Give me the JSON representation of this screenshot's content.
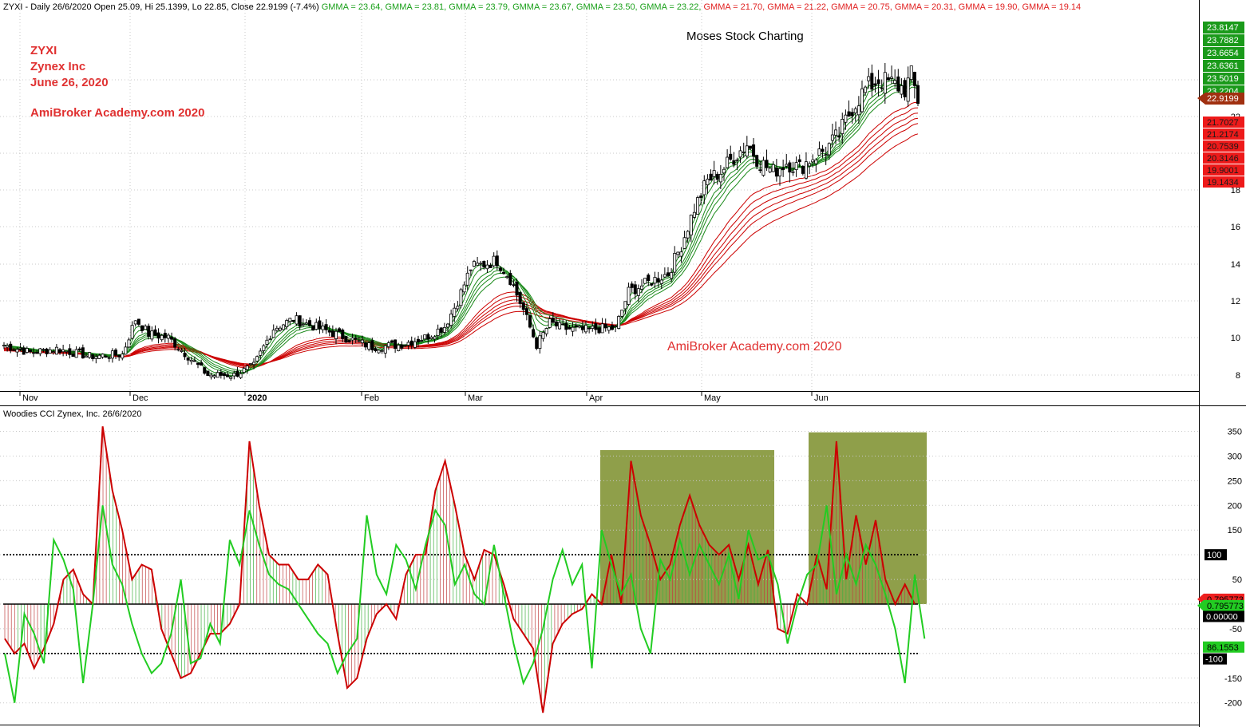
{
  "header": {
    "symbol": "ZYXI",
    "info": " - Daily 26/6/2020 Open 25.09, Hi 25.1399, Lo 22.85, Close 22.9199 (-7.4%)",
    "gmma": [
      {
        "text": "GMMA = 23.64,",
        "color": "#1aa01a"
      },
      {
        "text": "GMMA = 23.81,",
        "color": "#1aa01a"
      },
      {
        "text": "GMMA = 23.79,",
        "color": "#1aa01a"
      },
      {
        "text": "GMMA = 23.67,",
        "color": "#1aa01a"
      },
      {
        "text": "GMMA = 23.50,",
        "color": "#1aa01a"
      },
      {
        "text": "GMMA = 23.22,",
        "color": "#1aa01a"
      },
      {
        "text": "GMMA = 21.70,",
        "color": "#e02020"
      },
      {
        "text": "GMMA = 21.22,",
        "color": "#e02020"
      },
      {
        "text": "GMMA = 20.75,",
        "color": "#e02020"
      },
      {
        "text": "GMMA = 20.31,",
        "color": "#e02020"
      },
      {
        "text": "GMMA = 19.90,",
        "color": "#e02020"
      },
      {
        "text": "GMMA = 19.14",
        "color": "#e02020"
      }
    ]
  },
  "annotations": {
    "ticker": "ZYXI",
    "company": "Zynex Inc",
    "date": "June 26, 2020",
    "academy": "AmiBroker Academy.com  2020",
    "moses": "Moses Stock Charting",
    "academy_mid": "AmiBroker Academy.com  2020"
  },
  "cci_title": "Woodies CCI  Zynex, Inc. 26/6/2020",
  "colors": {
    "up": "#ffffff",
    "down": "#000000",
    "short_ma": "#1a8a1a",
    "long_ma": "#cc0000",
    "cci_up": "#cc0000",
    "cci_green": "#22cc22",
    "box": "#8f9f4a"
  },
  "chart_data": [
    {
      "type": "candlestick",
      "title": "ZYXI",
      "y_ticks": [
        8,
        10,
        12,
        14,
        16,
        18,
        22
      ],
      "ylim": [
        7,
        30
      ],
      "x_labels": [
        "Nov",
        "Dec",
        "2020",
        "Feb",
        "Mar",
        "Apr",
        "May",
        "Jun"
      ],
      "price_labels": {
        "green": [
          "23.8147",
          "23.7882",
          "23.6654",
          "23.6361",
          "23.5019",
          "23.2204"
        ],
        "close": "22.9199",
        "red": [
          "21.7027",
          "21.2174",
          "20.7539",
          "20.3146",
          "19.9001",
          "19.1434"
        ]
      },
      "close_path": [
        [
          0,
          9.6
        ],
        [
          8,
          9.2
        ],
        [
          16,
          9.4
        ],
        [
          26,
          9.0
        ],
        [
          36,
          9.1
        ],
        [
          40,
          11.0
        ],
        [
          44,
          10.2
        ],
        [
          50,
          10.0
        ],
        [
          56,
          9.0
        ],
        [
          62,
          8.0
        ],
        [
          70,
          8.0
        ],
        [
          76,
          8.5
        ],
        [
          82,
          10.5
        ],
        [
          88,
          11.0
        ],
        [
          96,
          10.5
        ],
        [
          104,
          10.0
        ],
        [
          112,
          9.5
        ],
        [
          120,
          9.6
        ],
        [
          128,
          10.0
        ],
        [
          134,
          10.6
        ],
        [
          138,
          12.0
        ],
        [
          142,
          13.8
        ],
        [
          146,
          14.0
        ],
        [
          150,
          14.2
        ],
        [
          154,
          13.2
        ],
        [
          158,
          11.5
        ],
        [
          162,
          9.6
        ],
        [
          166,
          10.8
        ],
        [
          170,
          10.5
        ],
        [
          176,
          10.4
        ],
        [
          182,
          10.5
        ],
        [
          186,
          10.5
        ],
        [
          190,
          12.5
        ],
        [
          196,
          13.0
        ],
        [
          202,
          13.5
        ],
        [
          206,
          15.0
        ],
        [
          210,
          17.0
        ],
        [
          214,
          18.5
        ],
        [
          218,
          19.0
        ],
        [
          222,
          19.8
        ],
        [
          226,
          20.5
        ],
        [
          230,
          19.5
        ],
        [
          234,
          19.0
        ],
        [
          238,
          19.5
        ],
        [
          242,
          19.2
        ],
        [
          246,
          19.8
        ],
        [
          250,
          20.2
        ],
        [
          254,
          21.0
        ],
        [
          258,
          22.5
        ],
        [
          262,
          23.5
        ],
        [
          266,
          24.0
        ],
        [
          270,
          23.8
        ],
        [
          274,
          23.5
        ],
        [
          276,
          24.2
        ],
        [
          278,
          22.9
        ]
      ],
      "gmma_short_last": [
        23.64,
        23.81,
        23.79,
        23.67,
        23.5,
        23.22
      ],
      "gmma_long_last": [
        21.7,
        21.22,
        20.75,
        20.31,
        19.9,
        19.14
      ]
    },
    {
      "type": "line",
      "title": "Woodies CCI  Zynex, Inc. 26/6/2020",
      "y_ticks": [
        350,
        300,
        250,
        200,
        150,
        100,
        50,
        0,
        -50,
        -100,
        -150,
        -200
      ],
      "ylim": [
        -240,
        370
      ],
      "reference_lines": [
        100,
        0,
        -100
      ],
      "axis_labels": {
        "plus100": "100",
        "zero": "0.00000",
        "minus100": "-100",
        "red_val": "0.795773",
        "green_val": "0.795773",
        "green_val2": "86.1553"
      },
      "series": [
        {
          "name": "CCI (red)",
          "values": [
            -70,
            -100,
            -80,
            -130,
            -90,
            -40,
            50,
            70,
            20,
            0,
            360,
            230,
            150,
            50,
            80,
            70,
            -50,
            -100,
            -150,
            -140,
            -100,
            -60,
            -60,
            -40,
            0,
            330,
            200,
            100,
            80,
            80,
            50,
            50,
            80,
            60,
            -60,
            -170,
            -150,
            -70,
            -20,
            0,
            -30,
            60,
            100,
            100,
            230,
            290,
            200,
            100,
            50,
            110,
            100,
            40,
            -30,
            -60,
            -90,
            -220,
            -80,
            -40,
            -20,
            -10,
            20,
            0,
            100,
            0,
            290,
            180,
            120,
            50,
            80,
            160,
            220,
            160,
            120,
            100,
            120,
            50,
            120,
            40,
            110,
            -50,
            -60,
            20,
            0,
            100,
            30,
            330,
            50,
            180,
            80,
            170,
            50,
            0,
            40,
            0
          ]
        },
        {
          "name": "Turbo CCI (green)",
          "values": [
            -100,
            -200,
            -20,
            -60,
            -120,
            130,
            90,
            30,
            -160,
            0,
            200,
            80,
            40,
            -40,
            -100,
            -140,
            -120,
            -60,
            50,
            -120,
            -110,
            -40,
            -80,
            130,
            80,
            190,
            120,
            60,
            40,
            30,
            0,
            -30,
            -60,
            -80,
            -140,
            -100,
            -70,
            180,
            60,
            20,
            120,
            90,
            30,
            120,
            190,
            160,
            40,
            80,
            20,
            0,
            120,
            20,
            -80,
            -160,
            -120,
            -50,
            50,
            110,
            40,
            80,
            -130,
            150,
            80,
            20,
            60,
            -50,
            -100,
            90,
            50,
            130,
            60,
            120,
            80,
            40,
            100,
            10,
            150,
            90,
            100,
            40,
            -80,
            0,
            60,
            80,
            200,
            20,
            100,
            40,
            120,
            80,
            20,
            -50,
            -160,
            60,
            -70
          ]
        }
      ]
    }
  ]
}
